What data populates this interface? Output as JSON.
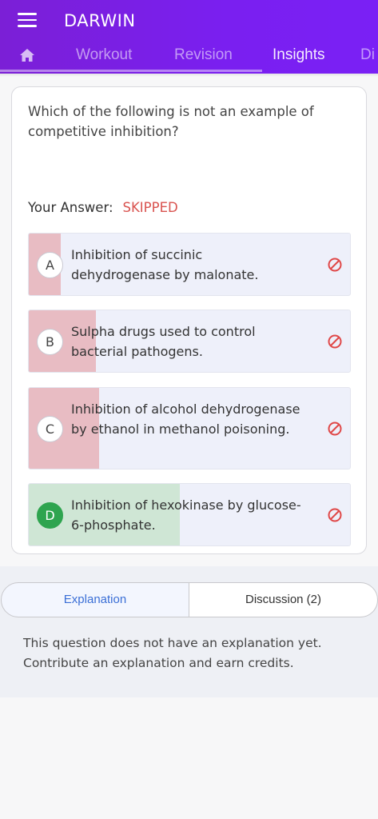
{
  "app": {
    "title": "DARWIN"
  },
  "nav": {
    "tabs": [
      {
        "label": "Workout"
      },
      {
        "label": "Revision"
      },
      {
        "label": "Insights"
      },
      {
        "label": "Di"
      }
    ],
    "active_tab": "Insights"
  },
  "question": {
    "text": "Which of the following is not an example of competitive inhibition?",
    "answer_label": "Your Answer:",
    "answer_status": "SKIPPED",
    "options": [
      {
        "letter": "A",
        "text": "Inhibition of succinic dehydrogenase by malonate.",
        "response_share": 0.1,
        "status": "incorrect"
      },
      {
        "letter": "B",
        "text": "Sulpha drugs used to control bacterial pathogens.",
        "response_share": 0.21,
        "status": "incorrect"
      },
      {
        "letter": "C",
        "text": "Inhibition of alcohol dehydrogenase by ethanol in methanol poisoning.",
        "response_share": 0.22,
        "status": "incorrect"
      },
      {
        "letter": "D",
        "text": "Inhibition of hexokinase by glucose-6-phosphate.",
        "response_share": 0.47,
        "status": "correct"
      }
    ]
  },
  "tabs_bottom": {
    "explanation_label": "Explanation",
    "discussion_label": "Discussion (2)"
  },
  "explanation": {
    "text": "This question does not have an explanation yet. Contribute an explanation and earn credits."
  },
  "colors": {
    "header": "#7a1ff0",
    "incorrect_fill": "#e8bcc3",
    "correct_fill": "#cfe6d5",
    "skipped_text": "#d9534f",
    "correct_badge": "#2ea44f",
    "link_blue": "#3b6fd6"
  },
  "icons": {
    "menu": "hamburger-menu-icon",
    "home": "home-icon",
    "option_status": "ban-icon"
  }
}
